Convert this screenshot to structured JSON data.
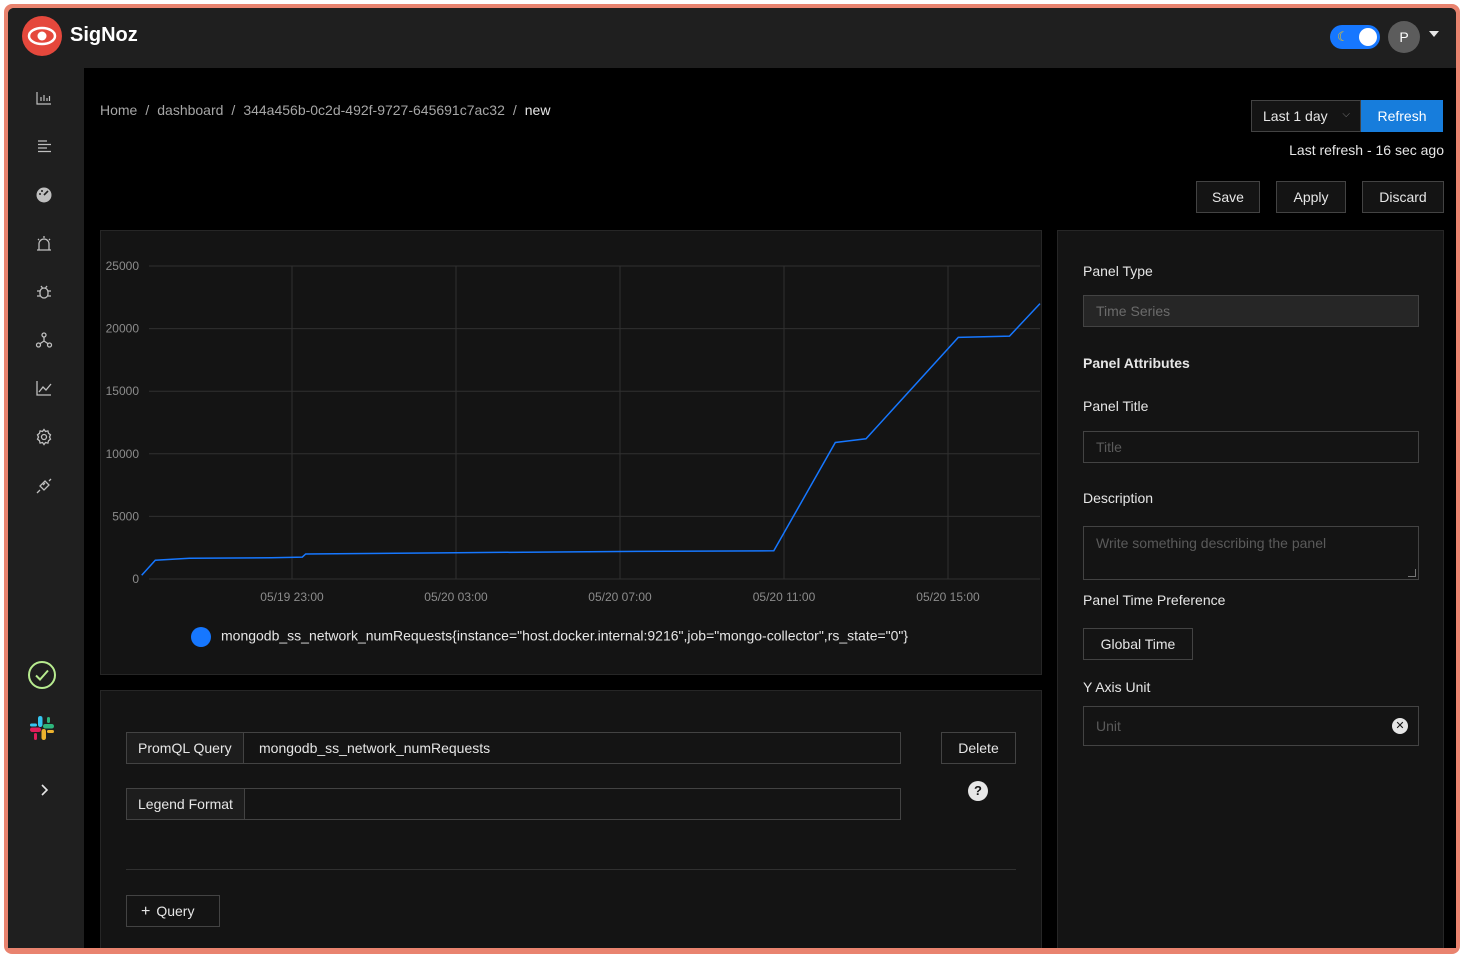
{
  "app": {
    "name": "SigNoz",
    "avatar_initial": "P"
  },
  "breadcrumb": [
    "Home",
    "dashboard",
    "344a456b-0c2d-492f-9727-645691c7ac32",
    "new"
  ],
  "header": {
    "time_range": "Last 1 day",
    "refresh_label": "Refresh",
    "last_refresh": "Last refresh - 16 sec ago"
  },
  "actions": {
    "save": "Save",
    "apply": "Apply",
    "discard": "Discard"
  },
  "chart_data": {
    "type": "line",
    "x_ticks": [
      "05/19 23:00",
      "05/20 03:00",
      "05/20 07:00",
      "05/20 11:00",
      "05/20 15:00"
    ],
    "y_ticks": [
      "25000",
      "20000",
      "15000",
      "10000",
      "5000",
      "0"
    ],
    "ylim": [
      0,
      25000
    ],
    "grid": true,
    "legend_position": "bottom",
    "series": [
      {
        "name": "mongodb_ss_network_numRequests{instance=\"host.docker.internal:9216\",job=\"mongo-collector\",rs_state=\"0\"}",
        "color": "#1677ff",
        "x": [
          "05/19 19:20",
          "05/19 19:40",
          "05/19 20:30",
          "05/19 22:30",
          "05/19 23:15",
          "05/19 23:20",
          "05/20 03:00",
          "05/20 07:00",
          "05/20 10:45",
          "05/20 12:15",
          "05/20 12:30",
          "05/20 13:00",
          "05/20 15:15",
          "05/20 16:30",
          "05/20 17:30"
        ],
        "y": [
          300,
          1500,
          1650,
          1700,
          1750,
          2000,
          2100,
          2200,
          2250,
          10900,
          11000,
          11200,
          19300,
          19400,
          22000
        ]
      }
    ]
  },
  "query": {
    "promql_label": "PromQL Query",
    "promql_value": "mongodb_ss_network_numRequests",
    "legend_label": "Legend Format",
    "legend_value": "",
    "delete_label": "Delete",
    "help_glyph": "?",
    "add_query_label": "Query"
  },
  "panel": {
    "type_label": "Panel Type",
    "type_value": "Time Series",
    "attributes_heading": "Panel Attributes",
    "title_label": "Panel Title",
    "title_placeholder": "Title",
    "description_label": "Description",
    "description_placeholder": "Write something describing the  panel",
    "time_pref_label": "Panel Time Preference",
    "time_pref_value": "Global Time",
    "y_unit_label": "Y Axis Unit",
    "y_unit_placeholder": "Unit"
  },
  "sidebar": {
    "icons": [
      "dashboard-icon",
      "logs-icon",
      "services-icon",
      "alerts-icon",
      "bug-icon",
      "service-map-icon",
      "metrics-chart-icon",
      "settings-icon",
      "integrations-icon",
      "status-check-icon",
      "slack-icon",
      "expand-chevron-icon"
    ]
  },
  "colors": {
    "accent": "#177ddc",
    "brand": "#e5483c",
    "series": "#1677ff",
    "status_ok": "#b7eb8f"
  }
}
